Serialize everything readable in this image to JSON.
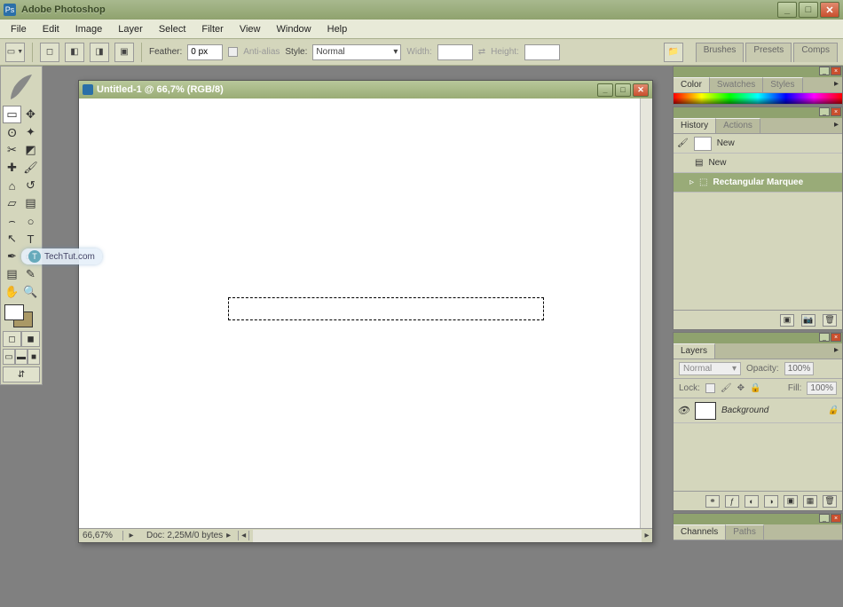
{
  "app": {
    "title": "Adobe Photoshop"
  },
  "menu": [
    "File",
    "Edit",
    "Image",
    "Layer",
    "Select",
    "Filter",
    "View",
    "Window",
    "Help"
  ],
  "options": {
    "feather_label": "Feather:",
    "feather_value": "0 px",
    "antialias_label": "Anti-alias",
    "style_label": "Style:",
    "style_value": "Normal",
    "width_label": "Width:",
    "height_label": "Height:",
    "palettes": [
      "Brushes",
      "Presets",
      "Comps"
    ]
  },
  "document": {
    "title": "Untitled-1 @ 66,7% (RGB/8)",
    "zoom": "66,67%",
    "info": "Doc: 2,25M/0 bytes"
  },
  "panels": {
    "color_tabs": [
      "Color",
      "Swatches",
      "Styles"
    ],
    "history_tabs": [
      "History",
      "Actions"
    ],
    "history_items": [
      {
        "label": "New",
        "selected": false,
        "thumb": true
      },
      {
        "label": "New",
        "selected": false,
        "thumb": false
      },
      {
        "label": "Rectangular Marquee",
        "selected": true,
        "thumb": false
      }
    ],
    "layers_tabs": [
      "Layers"
    ],
    "layer_mode": "Normal",
    "opacity_label": "Opacity:",
    "opacity_value": "100%",
    "lock_label": "Lock:",
    "fill_label": "Fill:",
    "fill_value": "100%",
    "layers": [
      {
        "name": "Background",
        "locked": true
      }
    ],
    "channels_tabs": [
      "Channels",
      "Paths"
    ]
  },
  "watermark": "TechTut.com"
}
